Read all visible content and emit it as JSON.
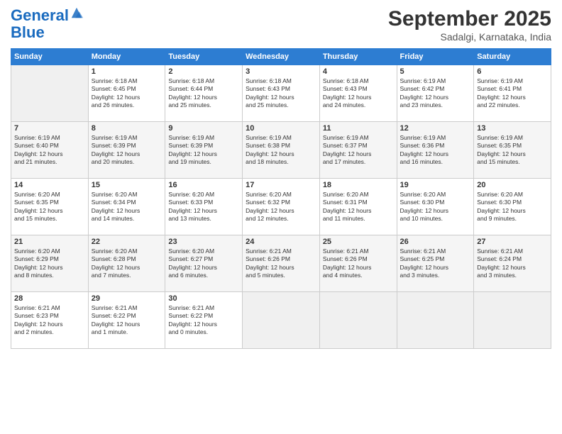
{
  "header": {
    "logo_line1": "General",
    "logo_line2": "Blue",
    "month": "September 2025",
    "location": "Sadalgi, Karnataka, India"
  },
  "weekdays": [
    "Sunday",
    "Monday",
    "Tuesday",
    "Wednesday",
    "Thursday",
    "Friday",
    "Saturday"
  ],
  "weeks": [
    [
      {
        "day": "",
        "info": ""
      },
      {
        "day": "1",
        "info": "Sunrise: 6:18 AM\nSunset: 6:45 PM\nDaylight: 12 hours\nand 26 minutes."
      },
      {
        "day": "2",
        "info": "Sunrise: 6:18 AM\nSunset: 6:44 PM\nDaylight: 12 hours\nand 25 minutes."
      },
      {
        "day": "3",
        "info": "Sunrise: 6:18 AM\nSunset: 6:43 PM\nDaylight: 12 hours\nand 25 minutes."
      },
      {
        "day": "4",
        "info": "Sunrise: 6:18 AM\nSunset: 6:43 PM\nDaylight: 12 hours\nand 24 minutes."
      },
      {
        "day": "5",
        "info": "Sunrise: 6:19 AM\nSunset: 6:42 PM\nDaylight: 12 hours\nand 23 minutes."
      },
      {
        "day": "6",
        "info": "Sunrise: 6:19 AM\nSunset: 6:41 PM\nDaylight: 12 hours\nand 22 minutes."
      }
    ],
    [
      {
        "day": "7",
        "info": "Sunrise: 6:19 AM\nSunset: 6:40 PM\nDaylight: 12 hours\nand 21 minutes."
      },
      {
        "day": "8",
        "info": "Sunrise: 6:19 AM\nSunset: 6:39 PM\nDaylight: 12 hours\nand 20 minutes."
      },
      {
        "day": "9",
        "info": "Sunrise: 6:19 AM\nSunset: 6:39 PM\nDaylight: 12 hours\nand 19 minutes."
      },
      {
        "day": "10",
        "info": "Sunrise: 6:19 AM\nSunset: 6:38 PM\nDaylight: 12 hours\nand 18 minutes."
      },
      {
        "day": "11",
        "info": "Sunrise: 6:19 AM\nSunset: 6:37 PM\nDaylight: 12 hours\nand 17 minutes."
      },
      {
        "day": "12",
        "info": "Sunrise: 6:19 AM\nSunset: 6:36 PM\nDaylight: 12 hours\nand 16 minutes."
      },
      {
        "day": "13",
        "info": "Sunrise: 6:19 AM\nSunset: 6:35 PM\nDaylight: 12 hours\nand 15 minutes."
      }
    ],
    [
      {
        "day": "14",
        "info": "Sunrise: 6:20 AM\nSunset: 6:35 PM\nDaylight: 12 hours\nand 15 minutes."
      },
      {
        "day": "15",
        "info": "Sunrise: 6:20 AM\nSunset: 6:34 PM\nDaylight: 12 hours\nand 14 minutes."
      },
      {
        "day": "16",
        "info": "Sunrise: 6:20 AM\nSunset: 6:33 PM\nDaylight: 12 hours\nand 13 minutes."
      },
      {
        "day": "17",
        "info": "Sunrise: 6:20 AM\nSunset: 6:32 PM\nDaylight: 12 hours\nand 12 minutes."
      },
      {
        "day": "18",
        "info": "Sunrise: 6:20 AM\nSunset: 6:31 PM\nDaylight: 12 hours\nand 11 minutes."
      },
      {
        "day": "19",
        "info": "Sunrise: 6:20 AM\nSunset: 6:30 PM\nDaylight: 12 hours\nand 10 minutes."
      },
      {
        "day": "20",
        "info": "Sunrise: 6:20 AM\nSunset: 6:30 PM\nDaylight: 12 hours\nand 9 minutes."
      }
    ],
    [
      {
        "day": "21",
        "info": "Sunrise: 6:20 AM\nSunset: 6:29 PM\nDaylight: 12 hours\nand 8 minutes."
      },
      {
        "day": "22",
        "info": "Sunrise: 6:20 AM\nSunset: 6:28 PM\nDaylight: 12 hours\nand 7 minutes."
      },
      {
        "day": "23",
        "info": "Sunrise: 6:20 AM\nSunset: 6:27 PM\nDaylight: 12 hours\nand 6 minutes."
      },
      {
        "day": "24",
        "info": "Sunrise: 6:21 AM\nSunset: 6:26 PM\nDaylight: 12 hours\nand 5 minutes."
      },
      {
        "day": "25",
        "info": "Sunrise: 6:21 AM\nSunset: 6:26 PM\nDaylight: 12 hours\nand 4 minutes."
      },
      {
        "day": "26",
        "info": "Sunrise: 6:21 AM\nSunset: 6:25 PM\nDaylight: 12 hours\nand 3 minutes."
      },
      {
        "day": "27",
        "info": "Sunrise: 6:21 AM\nSunset: 6:24 PM\nDaylight: 12 hours\nand 3 minutes."
      }
    ],
    [
      {
        "day": "28",
        "info": "Sunrise: 6:21 AM\nSunset: 6:23 PM\nDaylight: 12 hours\nand 2 minutes."
      },
      {
        "day": "29",
        "info": "Sunrise: 6:21 AM\nSunset: 6:22 PM\nDaylight: 12 hours\nand 1 minute."
      },
      {
        "day": "30",
        "info": "Sunrise: 6:21 AM\nSunset: 6:22 PM\nDaylight: 12 hours\nand 0 minutes."
      },
      {
        "day": "",
        "info": ""
      },
      {
        "day": "",
        "info": ""
      },
      {
        "day": "",
        "info": ""
      },
      {
        "day": "",
        "info": ""
      }
    ]
  ]
}
